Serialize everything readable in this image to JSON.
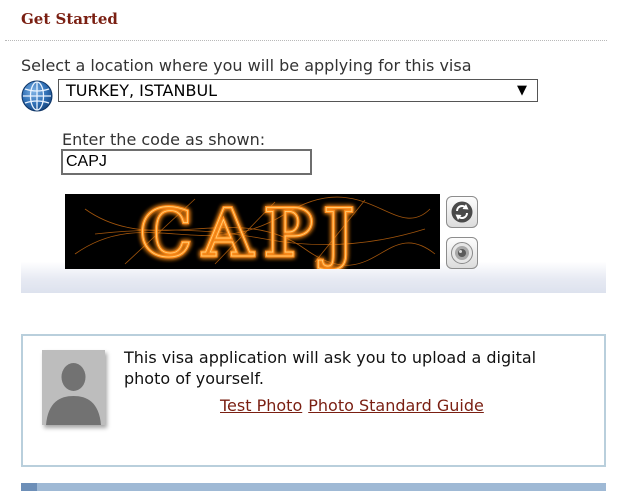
{
  "header": {
    "title": "Get Started"
  },
  "location": {
    "label": "Select a location where you will be applying for this visa",
    "selected": "TURKEY, ISTANBUL",
    "icon": "globe-icon"
  },
  "captcha": {
    "label": "Enter the code as shown:",
    "value": "CAPJ",
    "image_text": "CAPJ",
    "refresh_icon": "refresh-icon",
    "audio_icon": "speaker-icon"
  },
  "photo": {
    "message": "This visa application will ask you to upload a digital photo of yourself.",
    "test_photo_link": "Test Photo",
    "guide_link": "Photo Standard Guide",
    "avatar_icon": "user-silhouette-icon"
  },
  "colors": {
    "title": "#7a1f12",
    "link": "#7a1f12",
    "captcha_glow": "#ff8c1a",
    "photo_box_border": "#b9cfdc",
    "bottom_bar": "#9fb9d5"
  }
}
